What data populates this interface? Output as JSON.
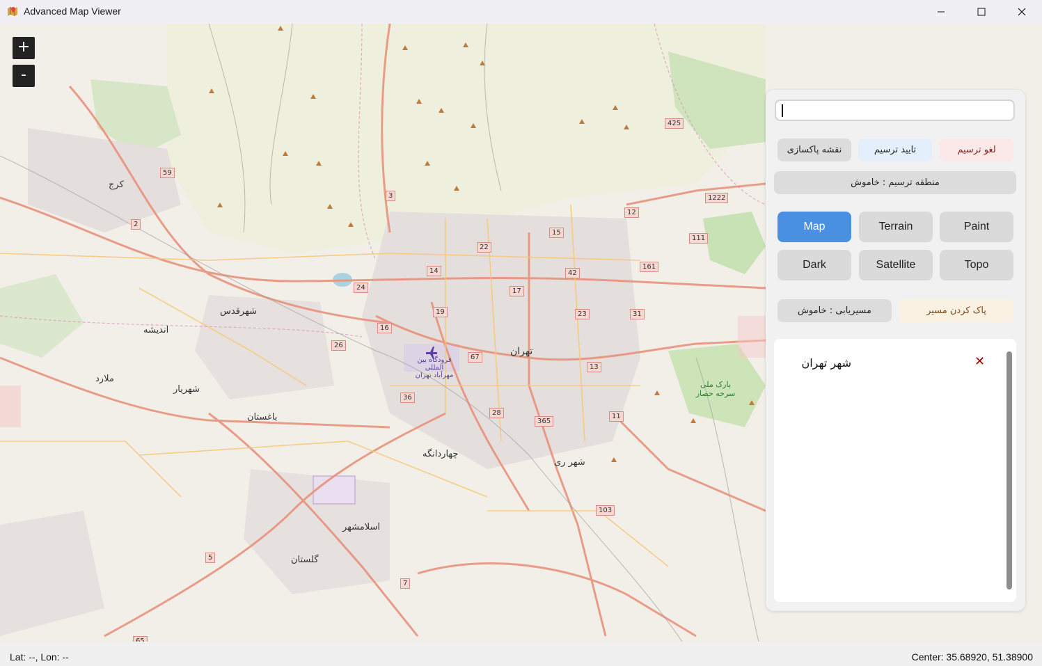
{
  "window": {
    "title": "Advanced Map Viewer",
    "minimize_icon": "minimize-icon",
    "maximize_icon": "maximize-icon",
    "close_icon": "close-icon"
  },
  "map": {
    "zoom_in_label": "+",
    "zoom_out_label": "-",
    "labels": {
      "tehran": "تهران",
      "karaj": "کرج",
      "shahr_rey": "شهر ری",
      "shahriar": "شهریار",
      "eslamshahr": "اسلامشهر",
      "baghestan": "باغستان",
      "chahardangeh": "چهاردانگه",
      "shahr_qods": "شهرقدس",
      "golestan": "گلستان",
      "andisheh": "اندیشه",
      "malard": "ملارد",
      "pardis_park": "پارک ملی سرخه حصار",
      "airport": "فرودگاه بین المللی مهرآباد تهران"
    },
    "road_numbers": [
      "59",
      "2",
      "3",
      "425",
      "1222",
      "12",
      "15",
      "22",
      "111",
      "161",
      "14",
      "42",
      "24",
      "17",
      "19",
      "23",
      "31",
      "16",
      "26",
      "67",
      "13",
      "36",
      "28",
      "365",
      "11",
      "103",
      "5",
      "7",
      "65"
    ]
  },
  "panel": {
    "search": {
      "value": "",
      "placeholder": ""
    },
    "draw_buttons": {
      "clear_map": "نقشه پاکسازی",
      "confirm_draw": "تایید ترسیم",
      "cancel_draw": "لغو ترسیم"
    },
    "draw_area_status": "منطقه ترسیم : خاموش",
    "layers": [
      {
        "label": "Map",
        "active": true
      },
      {
        "label": "Terrain",
        "active": false
      },
      {
        "label": "Paint",
        "active": false
      },
      {
        "label": "Dark",
        "active": false
      },
      {
        "label": "Satellite",
        "active": false
      },
      {
        "label": "Topo",
        "active": false
      }
    ],
    "routing_status": "مسیریابی : خاموش",
    "clear_route": "پاک کردن مسیر",
    "info": {
      "title": "شهر تهران",
      "close_icon": "close-x-icon"
    }
  },
  "status": {
    "coords": "Lat: --, Lon: --",
    "center": "Center: 35.68920, 51.38900"
  },
  "colors": {
    "active_layer": "#4a90e2",
    "confirm_bg": "#e3effb",
    "cancel_bg": "#fbe8e8",
    "clear_route_bg": "#fbf1e3",
    "road_major": "#e8927c",
    "road_minor": "#f7c97a"
  }
}
